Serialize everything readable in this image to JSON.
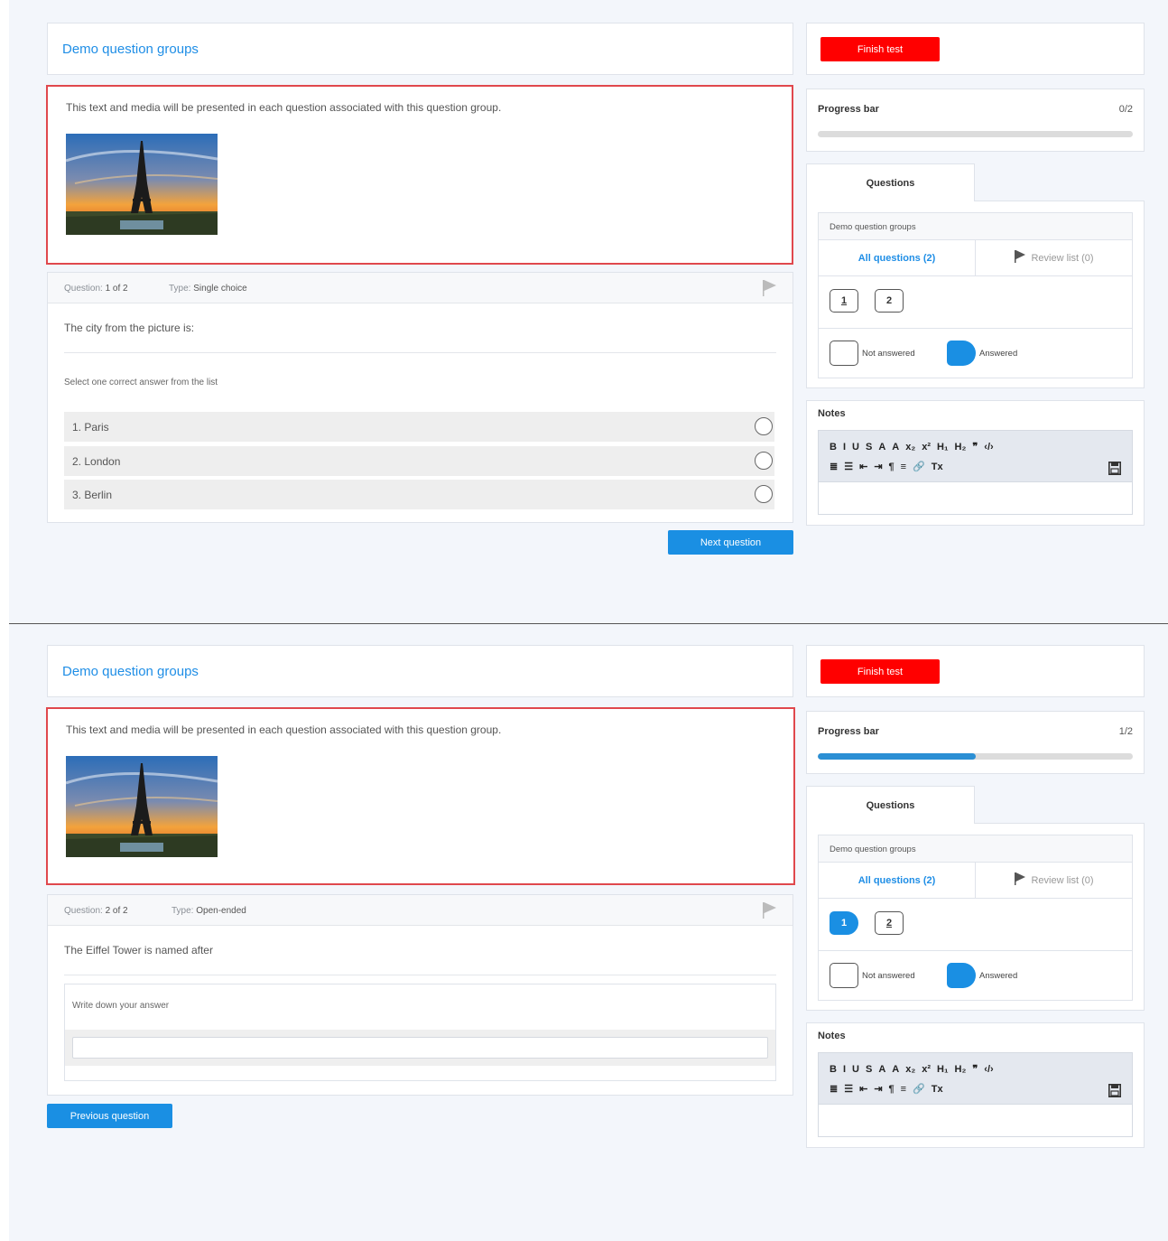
{
  "screens": [
    {
      "group_title": "Demo question groups",
      "group_text": "This text and media will be presented in each question associated with this question group.",
      "question": {
        "number_label": "Question:",
        "number_value": "1 of 2",
        "type_label": "Type:",
        "type_value": "Single choice",
        "text": "The city from the picture is:",
        "hint": "Select one correct answer from the list",
        "options": [
          {
            "label": "1.  Paris"
          },
          {
            "label": "2.  London"
          },
          {
            "label": "3.  Berlin"
          }
        ]
      },
      "nav_button": "Next question",
      "sidebar": {
        "finish_label": "Finish test",
        "progress_title": "Progress bar",
        "progress_count": "0/2",
        "progress_fraction": 0,
        "questions_tab": "Questions",
        "group_name": "Demo question groups",
        "all_questions": "All questions (2)",
        "review_list": "Review list (0)",
        "question_numbers": [
          {
            "n": "1",
            "answered": false,
            "current": true
          },
          {
            "n": "2",
            "answered": false,
            "current": false
          }
        ],
        "legend_not_answered": "Not answered",
        "legend_answered": "Answered",
        "notes_title": "Notes"
      }
    },
    {
      "group_title": "Demo question groups",
      "group_text": "This text and media will be presented in each question associated with this question group.",
      "question": {
        "number_label": "Question:",
        "number_value": "2 of 2",
        "type_label": "Type:",
        "type_value": "Open-ended",
        "text": "The Eiffel Tower is named after",
        "answer_label": "Write down your answer",
        "answer_value": ""
      },
      "nav_button": "Previous question",
      "sidebar": {
        "finish_label": "Finish test",
        "progress_title": "Progress bar",
        "progress_count": "1/2",
        "progress_fraction": 0.5,
        "questions_tab": "Questions",
        "group_name": "Demo question groups",
        "all_questions": "All questions (2)",
        "review_list": "Review list (0)",
        "question_numbers": [
          {
            "n": "1",
            "answered": true,
            "current": false
          },
          {
            "n": "2",
            "answered": false,
            "current": true
          }
        ],
        "legend_not_answered": "Not answered",
        "legend_answered": "Answered",
        "notes_title": "Notes"
      }
    }
  ],
  "toolbar": {
    "row1": [
      "B",
      "I",
      "U",
      "S",
      "A",
      "A",
      "x₂",
      "x²",
      "H₁",
      "H₂",
      "❞",
      "‹/›"
    ],
    "row2": [
      "≣",
      "☰",
      "⇤",
      "⇥",
      "¶",
      "≡",
      "🔗",
      "Tx"
    ]
  },
  "colors": {
    "accent": "#1a8fe3",
    "finish": "#ff0000",
    "group_border": "#e0484d",
    "background": "#f3f6fb"
  }
}
